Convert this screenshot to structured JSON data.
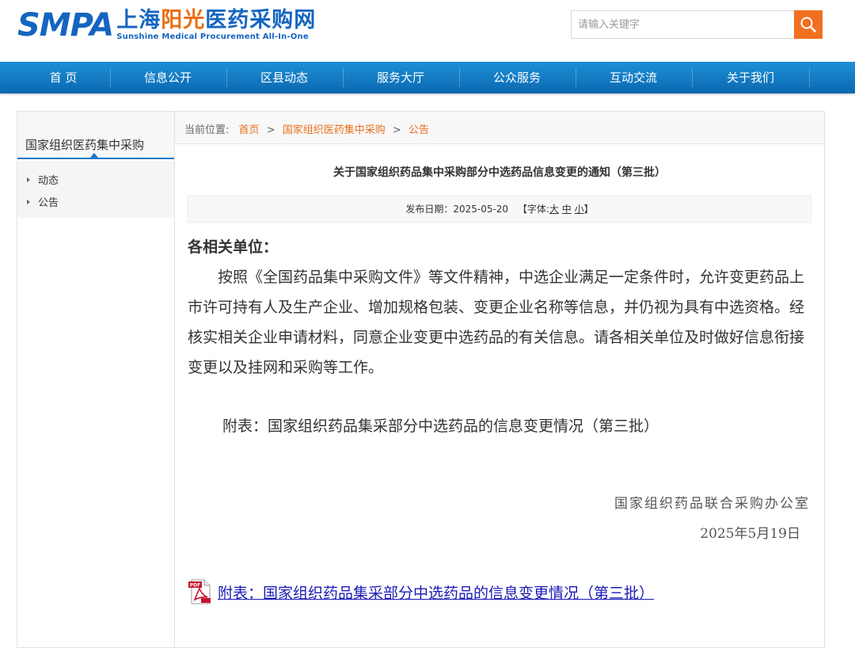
{
  "header": {
    "logo_smpa": "SMPA",
    "logo_cn_prefix": "上海",
    "logo_cn_highlight": "阳光",
    "logo_cn_suffix": "医药采购网",
    "logo_en": "Sunshine Medical Procurement All-In-One",
    "search_placeholder": "请输入关键字",
    "search_icon": "search-icon"
  },
  "nav": {
    "items": [
      "首 页",
      "信息公开",
      "区县动态",
      "服务大厅",
      "公众服务",
      "互动交流",
      "关于我们"
    ]
  },
  "sidebar": {
    "title": "国家组织医药集中采购",
    "items": [
      "动态",
      "公告"
    ]
  },
  "breadcrumb": {
    "prefix": "当前位置:",
    "items": [
      "首页",
      "国家组织医药集中采购",
      "公告"
    ],
    "separator": ">"
  },
  "article": {
    "title": "关于国家组织药品集中采购部分中选药品信息变更的通知（第三批）",
    "date_label": "发布日期：",
    "date": "2025-05-20",
    "font_label": "【字体:",
    "font_large": "大",
    "font_medium": "中",
    "font_small": "小",
    "font_end": "】",
    "salutation": "各相关单位：",
    "body": "按照《全国药品集中采购文件》等文件精神，中选企业满足一定条件时，允许变更药品上市许可持有人及生产企业、增加规格包装、变更企业名称等信息，并仍视为具有中选资格。经核实相关企业申请材料，同意企业变更中选药品的有关信息。请各相关单位及时做好信息衔接变更以及挂网和采购等工作。",
    "attachment_note": "附表：国家组织药品集采部分中选药品的信息变更情况（第三批）",
    "signature_org": "国家组织药品联合采购办公室",
    "signature_date": "2025年5月19日",
    "attachment_link": "附表：国家组织药品集采部分中选药品的信息变更情况（第三批）",
    "attachment_icon": "pdf-file-icon"
  },
  "colors": {
    "brand_blue": "#1565c0",
    "accent_orange": "#e8701e",
    "nav_blue": "#0a68b0",
    "link_blue": "#1a1ab5"
  }
}
